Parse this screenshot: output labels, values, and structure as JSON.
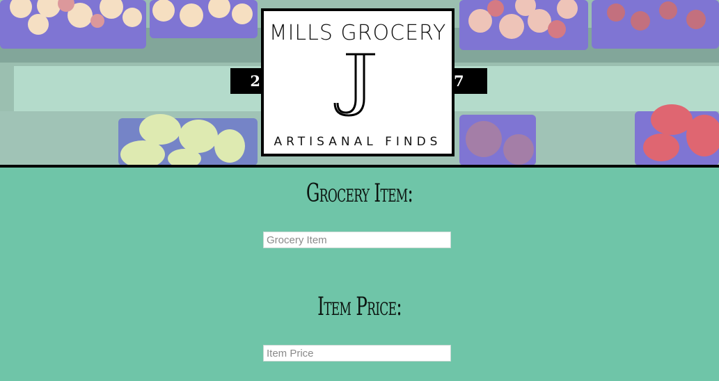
{
  "header": {
    "logo": {
      "title": "MILLS GROCERY",
      "monogram": "J",
      "year_left": "20",
      "year_right": "17",
      "subtitle": "ARTISANAL FINDS"
    }
  },
  "form": {
    "item": {
      "label": "Grocery Item:",
      "placeholder": "Grocery Item",
      "value": ""
    },
    "price": {
      "label": "Item Price:",
      "placeholder": "Item Price",
      "value": ""
    }
  },
  "colors": {
    "page_background": "#6fc5a8",
    "logo_background": "#ffffff",
    "logo_ink": "#000000"
  }
}
